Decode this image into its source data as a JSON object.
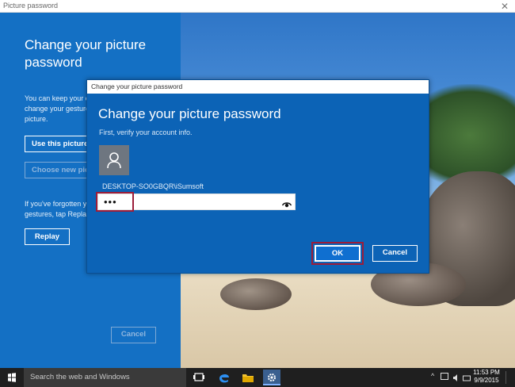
{
  "window": {
    "title": "Picture password",
    "close_glyph": "✕"
  },
  "panel": {
    "heading": "Change your picture password",
    "desc_line1": "You can keep your c",
    "desc_line2": "change your gestures",
    "desc_line3": "picture.",
    "use_picture_label": "Use this picture",
    "choose_picture_label": "Choose new pictu",
    "forgot_line1": "If you've forgotten y",
    "forgot_line2": "gestures, tap Replay",
    "replay_label": "Replay",
    "cancel_label": "Cancel"
  },
  "dialog": {
    "titlebar": "Change your picture password",
    "heading": "Change your picture password",
    "subtitle": "First, verify your account info.",
    "avatar_icon": "user-icon",
    "username": "DESKTOP-SO0GBQR\\iSumsoft",
    "password_mask": "•••",
    "reveal_icon": "eye-icon",
    "ok_label": "OK",
    "cancel_label": "Cancel",
    "highlight_color": "#9b1d3a"
  },
  "taskbar": {
    "search_placeholder": "Search the web and Windows",
    "apps": [
      "task-view-icon",
      "edge-icon",
      "file-explorer-icon",
      "settings-icon"
    ],
    "time": "11:53 PM",
    "date": "9/9/2015"
  },
  "colors": {
    "accent": "#1574c9",
    "dialog_bg": "#0c63b6",
    "taskbar": "#1f1f1f"
  }
}
